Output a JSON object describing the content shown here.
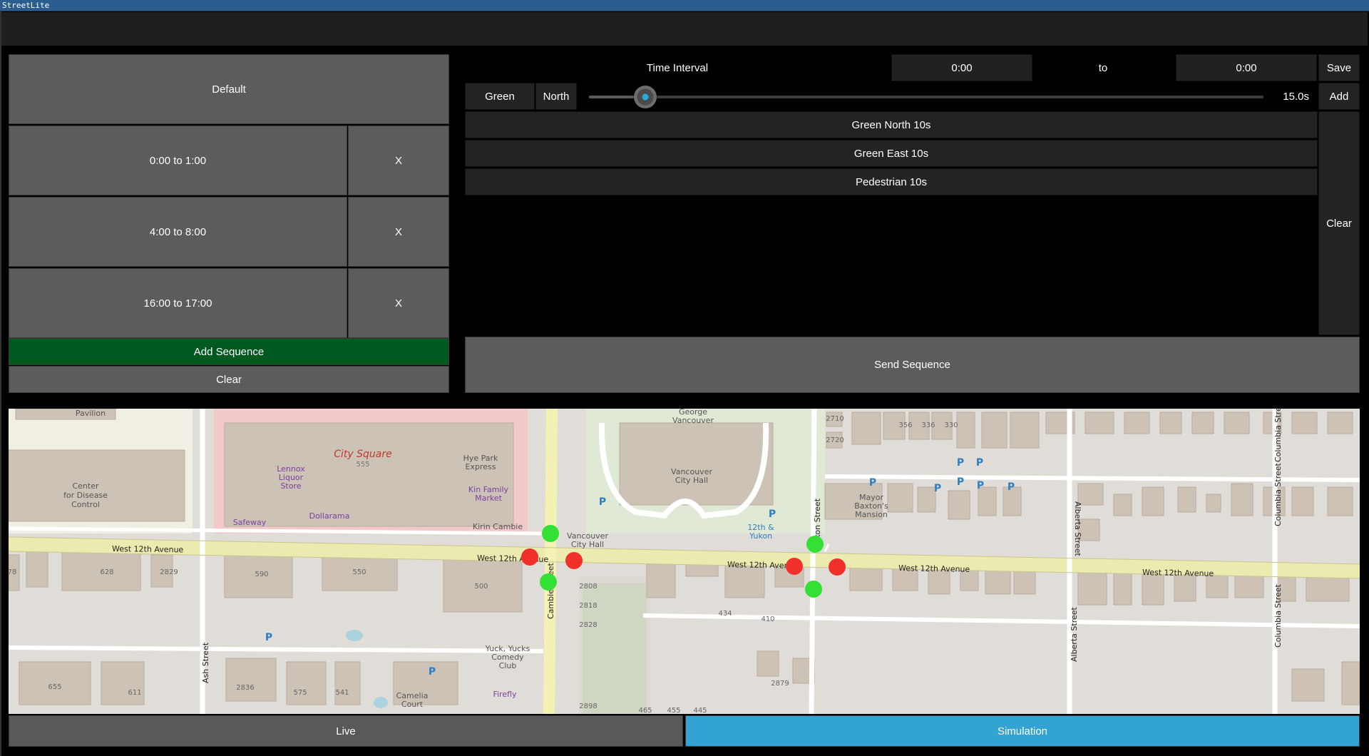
{
  "app": {
    "title": "StreetLite"
  },
  "sequences": {
    "default_label": "Default",
    "items": [
      {
        "label": "0:00 to 1:00",
        "remove": "X"
      },
      {
        "label": "4:00 to 8:00",
        "remove": "X"
      },
      {
        "label": "16:00 to 17:00",
        "remove": "X"
      }
    ],
    "add_label": "Add Sequence",
    "clear_label": "Clear"
  },
  "editor": {
    "time_interval_label": "Time Interval",
    "start_value": "0:00",
    "to_label": "to",
    "end_value": "0:00",
    "save_label": "Save",
    "phase_color": "Green",
    "phase_direction": "North",
    "duration_value": 15.0,
    "duration_text": "15.0s",
    "duration_fraction": 0.084,
    "add_label": "Add",
    "steps": [
      "Green North 10s",
      "Green East 10s",
      "Pedestrian 10s"
    ],
    "clear_label": "Clear",
    "send_label": "Send Sequence"
  },
  "map": {
    "places": {
      "pavilion": "Pavilion",
      "city_square": "City Square",
      "cdc": [
        "Center",
        "for Disease",
        "Control"
      ],
      "lennox": [
        "Lennox",
        "Liquor",
        "Store"
      ],
      "hye_park": [
        "Hye Park",
        "Express"
      ],
      "kin_family": [
        "Kin Family",
        "Market"
      ],
      "safeway": "Safeway",
      "dollarama": "Dollarama",
      "kirin": "Kirin Cambie",
      "george": [
        "George",
        "Vancouver"
      ],
      "city_hall": [
        "Vancouver",
        "City Hall"
      ],
      "city_hall_2": [
        "Vancouver",
        "City Hall"
      ],
      "twelfth_yukon": [
        "12th &",
        "Yukon"
      ],
      "mayor": [
        "Mayor",
        "Baxton's",
        "Mansion"
      ],
      "yuck": [
        "Yuck, Yucks",
        "Comedy",
        "Club"
      ],
      "firefly": "Firefly",
      "camelia": [
        "Camelia",
        "Court"
      ]
    },
    "streets": {
      "w12_a": "West 12th Avenue",
      "w12_b": "West 12th Avenue",
      "w12_c": "West 12th Avenue",
      "w12_d": "West 12th Avenue",
      "w12_e": "West 12th Avenue",
      "cambie": "Cambie Street",
      "yukon": "Yukon Street",
      "alberta_a": "Alberta Street",
      "alberta_b": "Alberta Street",
      "ash": "Ash Street",
      "columbia_a": "Columbia Street",
      "columbia_b": "Columbia Street",
      "columbia_c": "Columbia Street"
    },
    "numbers": [
      "555",
      "2710",
      "2720",
      "356",
      "336",
      "330",
      "628",
      "2829",
      "590",
      "550",
      "500",
      "2808",
      "2818",
      "2828",
      "434",
      "410",
      "2879",
      "655",
      "611",
      "2836",
      "575",
      "541",
      "2898",
      "465",
      "455",
      "445",
      "78"
    ],
    "signal_colors": {
      "green": "#33e033",
      "red": "#f0302a"
    }
  },
  "modes": {
    "live_label": "Live",
    "simulation_label": "Simulation"
  },
  "colors": {
    "accent": "#33a3d4",
    "add_sequence": "#005a20"
  }
}
